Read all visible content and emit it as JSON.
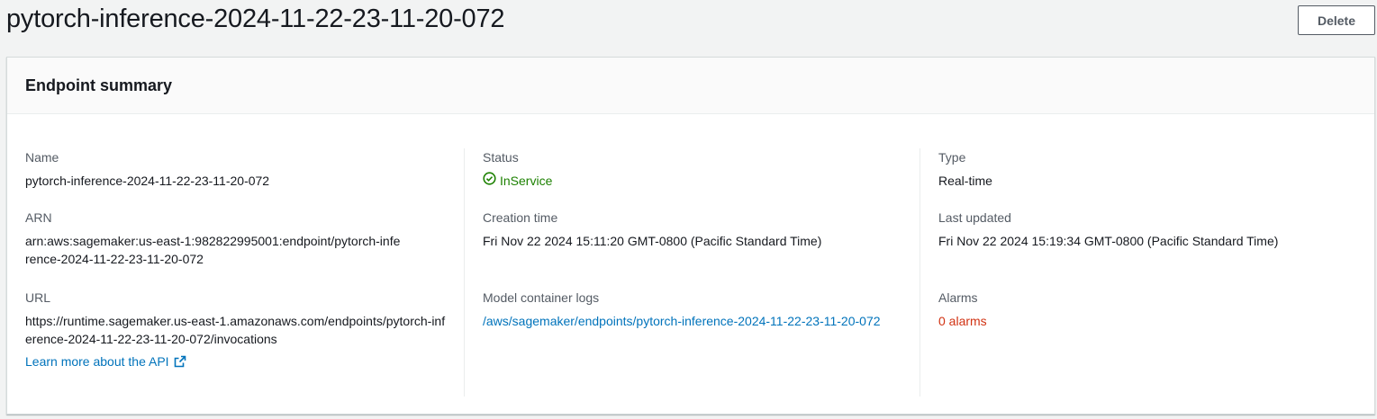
{
  "header": {
    "title": "pytorch-inference-2024-11-22-23-11-20-072",
    "delete_label": "Delete"
  },
  "panel": {
    "title": "Endpoint summary"
  },
  "fields": {
    "name": {
      "label": "Name",
      "value": "pytorch-inference-2024-11-22-23-11-20-072"
    },
    "status": {
      "label": "Status",
      "value": "InService",
      "icon": "check-circle-icon",
      "color": "#1d8102"
    },
    "type": {
      "label": "Type",
      "value": "Real-time"
    },
    "arn": {
      "label": "ARN",
      "value": "arn:aws:sagemaker:us-east-1:982822995001:endpoint/pytorch-inference-2024-11-22-23-11-20-072"
    },
    "creation_time": {
      "label": "Creation time",
      "value": "Fri Nov 22 2024 15:11:20 GMT-0800 (Pacific Standard Time)"
    },
    "last_updated": {
      "label": "Last updated",
      "value": "Fri Nov 22 2024 15:19:34 GMT-0800 (Pacific Standard Time)"
    },
    "url": {
      "label": "URL",
      "value": "https://runtime.sagemaker.us-east-1.amazonaws.com/endpoints/pytorch-inference-2024-11-22-23-11-20-072/invocations",
      "learn_more": "Learn more about the API",
      "learn_more_icon": "external-link-icon"
    },
    "logs": {
      "label": "Model container logs",
      "value": "/aws/sagemaker/endpoints/pytorch-inference-2024-11-22-23-11-20-072"
    },
    "alarms": {
      "label": "Alarms",
      "value": "0 alarms",
      "color": "#d13212"
    }
  },
  "colors": {
    "link": "#0073bb",
    "success": "#1d8102",
    "error": "#d13212"
  }
}
